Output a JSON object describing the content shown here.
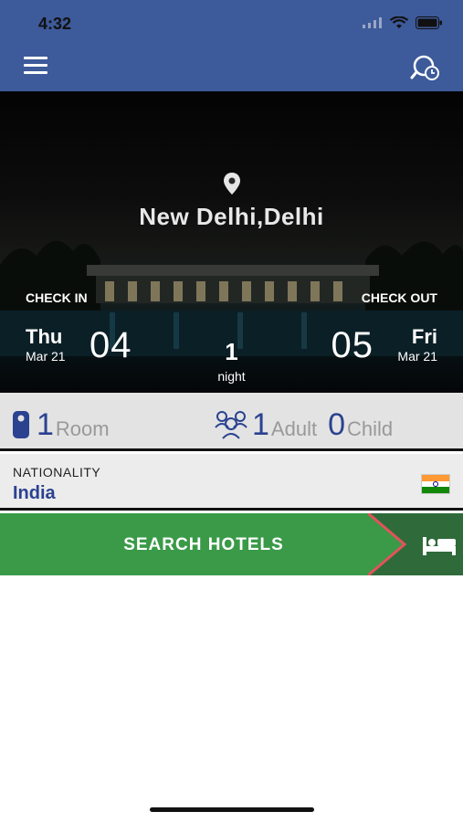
{
  "status_bar": {
    "time": "4:32"
  },
  "hero": {
    "city": "New Delhi,Delhi",
    "check_in_label": "CHECK IN",
    "check_out_label": "CHECK OUT",
    "check_in": {
      "day": "Thu",
      "month": "Mar 21",
      "date": "04"
    },
    "check_out": {
      "day": "Fri",
      "month": "Mar 21",
      "date": "05"
    },
    "nights": {
      "count": "1",
      "label": "night"
    }
  },
  "guests": {
    "rooms": {
      "count": "1",
      "label": "Room"
    },
    "adults": {
      "count": "1",
      "label": "Adult"
    },
    "children": {
      "count": "0",
      "label": "Child"
    }
  },
  "nationality": {
    "label": "NATIONALITY",
    "value": "India",
    "flag_colors": [
      "#FF9933",
      "#FFFFFF",
      "#138808"
    ]
  },
  "search": {
    "label": "SEARCH HOTELS"
  },
  "colors": {
    "brand": "#3d5a9a",
    "accent": "#2a4290",
    "search": "#3a9a48",
    "arrow": "#e0545a"
  }
}
